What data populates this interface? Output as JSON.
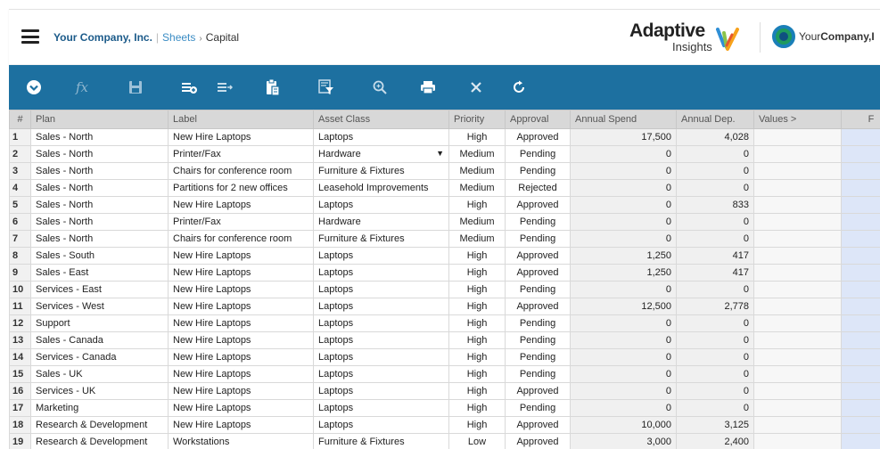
{
  "header": {
    "company": "Your Company, Inc.",
    "sheets_link": "Sheets",
    "separator": "›",
    "current_sheet": "Capital"
  },
  "brand": {
    "adaptive_word1": "Adaptive",
    "adaptive_word2": "Insights",
    "yourcompany_prefix": "Your",
    "yourcompany_bold": "Company,I"
  },
  "toolbar": {
    "fx_label": "fx",
    "icons": [
      "chevron-down-circle-icon",
      "fx-icon",
      "save-icon",
      "insert-row-icon",
      "insert-row-alt-icon",
      "paste-icon",
      "filter-icon",
      "zoom-icon",
      "print-icon",
      "close-icon",
      "refresh-icon"
    ]
  },
  "colors": {
    "toolbar_bg": "#1d70a0",
    "header_company": "#1c5b8a",
    "link": "#3a8cc4",
    "last_col_bg": "#dde6f8"
  },
  "table": {
    "columns": [
      "#",
      "Plan",
      "Label",
      "Asset Class",
      "Priority",
      "Approval",
      "Annual Spend",
      "Annual Dep.",
      "Values >",
      "F"
    ],
    "rows": [
      {
        "n": "1",
        "plan": "Sales - North",
        "label": "New Hire Laptops",
        "asset": "Laptops",
        "priority": "High",
        "approval": "Approved",
        "spend": "17,500",
        "dep": "4,028"
      },
      {
        "n": "2",
        "plan": "Sales - North",
        "label": "Printer/Fax",
        "asset": "Hardware",
        "priority": "Medium",
        "approval": "Pending",
        "spend": "0",
        "dep": "0"
      },
      {
        "n": "3",
        "plan": "Sales - North",
        "label": "Chairs for conference room",
        "asset": "Furniture & Fixtures",
        "priority": "Medium",
        "approval": "Pending",
        "spend": "0",
        "dep": "0"
      },
      {
        "n": "4",
        "plan": "Sales - North",
        "label": "Partitions for 2 new offices",
        "asset": "Leasehold Improvements",
        "priority": "Medium",
        "approval": "Rejected",
        "spend": "0",
        "dep": "0"
      },
      {
        "n": "5",
        "plan": "Sales - North",
        "label": "New Hire Laptops",
        "asset": "Laptops",
        "priority": "High",
        "approval": "Approved",
        "spend": "0",
        "dep": "833"
      },
      {
        "n": "6",
        "plan": "Sales - North",
        "label": "Printer/Fax",
        "asset": "Hardware",
        "priority": "Medium",
        "approval": "Pending",
        "spend": "0",
        "dep": "0"
      },
      {
        "n": "7",
        "plan": "Sales - North",
        "label": "Chairs for conference room",
        "asset": "Furniture & Fixtures",
        "priority": "Medium",
        "approval": "Pending",
        "spend": "0",
        "dep": "0"
      },
      {
        "n": "8",
        "plan": "Sales - South",
        "label": "New Hire Laptops",
        "asset": "Laptops",
        "priority": "High",
        "approval": "Approved",
        "spend": "1,250",
        "dep": "417"
      },
      {
        "n": "9",
        "plan": "Sales - East",
        "label": "New Hire Laptops",
        "asset": "Laptops",
        "priority": "High",
        "approval": "Approved",
        "spend": "1,250",
        "dep": "417"
      },
      {
        "n": "10",
        "plan": "Services - East",
        "label": "New Hire Laptops",
        "asset": "Laptops",
        "priority": "High",
        "approval": "Pending",
        "spend": "0",
        "dep": "0"
      },
      {
        "n": "11",
        "plan": "Services - West",
        "label": "New Hire Laptops",
        "asset": "Laptops",
        "priority": "High",
        "approval": "Approved",
        "spend": "12,500",
        "dep": "2,778"
      },
      {
        "n": "12",
        "plan": "Support",
        "label": "New Hire Laptops",
        "asset": "Laptops",
        "priority": "High",
        "approval": "Pending",
        "spend": "0",
        "dep": "0"
      },
      {
        "n": "13",
        "plan": "Sales - Canada",
        "label": "New Hire Laptops",
        "asset": "Laptops",
        "priority": "High",
        "approval": "Pending",
        "spend": "0",
        "dep": "0"
      },
      {
        "n": "14",
        "plan": "Services - Canada",
        "label": "New Hire Laptops",
        "asset": "Laptops",
        "priority": "High",
        "approval": "Pending",
        "spend": "0",
        "dep": "0"
      },
      {
        "n": "15",
        "plan": "Sales - UK",
        "label": "New Hire Laptops",
        "asset": "Laptops",
        "priority": "High",
        "approval": "Pending",
        "spend": "0",
        "dep": "0"
      },
      {
        "n": "16",
        "plan": "Services - UK",
        "label": "New Hire Laptops",
        "asset": "Laptops",
        "priority": "High",
        "approval": "Approved",
        "spend": "0",
        "dep": "0"
      },
      {
        "n": "17",
        "plan": "Marketing",
        "label": "New Hire Laptops",
        "asset": "Laptops",
        "priority": "High",
        "approval": "Pending",
        "spend": "0",
        "dep": "0"
      },
      {
        "n": "18",
        "plan": "Research & Development",
        "label": "New Hire Laptops",
        "asset": "Laptops",
        "priority": "High",
        "approval": "Approved",
        "spend": "10,000",
        "dep": "3,125"
      },
      {
        "n": "19",
        "plan": "Research & Development",
        "label": "Workstations",
        "asset": "Furniture & Fixtures",
        "priority": "Low",
        "approval": "Approved",
        "spend": "3,000",
        "dep": "2,400"
      }
    ]
  }
}
